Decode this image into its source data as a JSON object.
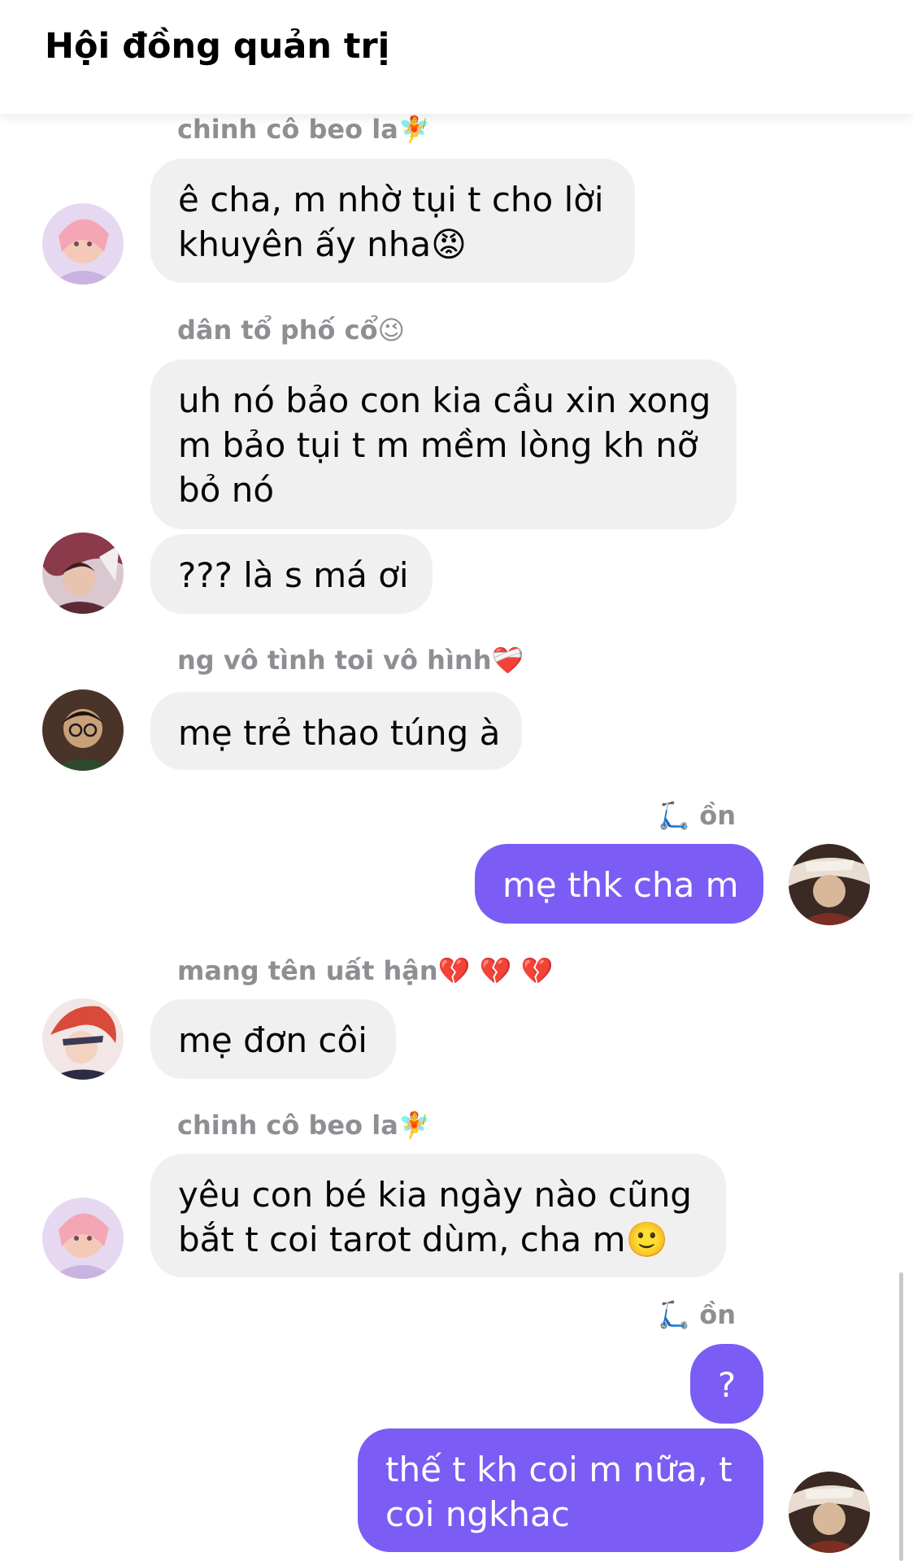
{
  "header": {
    "title": "Hội đồng quản trị"
  },
  "messages": {
    "m1": {
      "sender": "chinh cô beo la🧚",
      "lines": [
        "ê cha, m nhờ tụi t cho lời",
        "khuyên ấy nha😡"
      ]
    },
    "m2": {
      "sender": "dân tổ phố cổ😉",
      "lines": [
        "uh nó bảo con kia cầu xin xong",
        "m bảo tụi t m mềm lòng kh nỡ",
        "bỏ nó"
      ]
    },
    "m3": {
      "lines": [
        "??? là s má ơi"
      ]
    },
    "m4": {
      "sender": "ng vô tình toi vô hình❤️‍🩹",
      "lines": [
        "mẹ trẻ thao túng à"
      ]
    },
    "m5": {
      "sender": "🛴 ồn",
      "lines": [
        "mẹ thk cha m"
      ]
    },
    "m6": {
      "sender": "mang tên uất hận💔 💔 💔",
      "lines": [
        "mẹ đơn côi"
      ]
    },
    "m7": {
      "sender": "chinh cô beo la🧚",
      "lines": [
        "yêu con bé kia ngày nào cũng",
        "bắt t coi tarot dùm, cha m🙂"
      ]
    },
    "m8": {
      "sender": "🛴 ồn",
      "lines": [
        "?"
      ]
    },
    "m9": {
      "lines": [
        "thế t kh coi m nữa, t",
        "coi ngkhac"
      ]
    }
  },
  "colors": {
    "outgoing_bubble": "#7b5cf5",
    "incoming_bubble": "#f0f0f0",
    "sender_name": "#8e8e93"
  }
}
